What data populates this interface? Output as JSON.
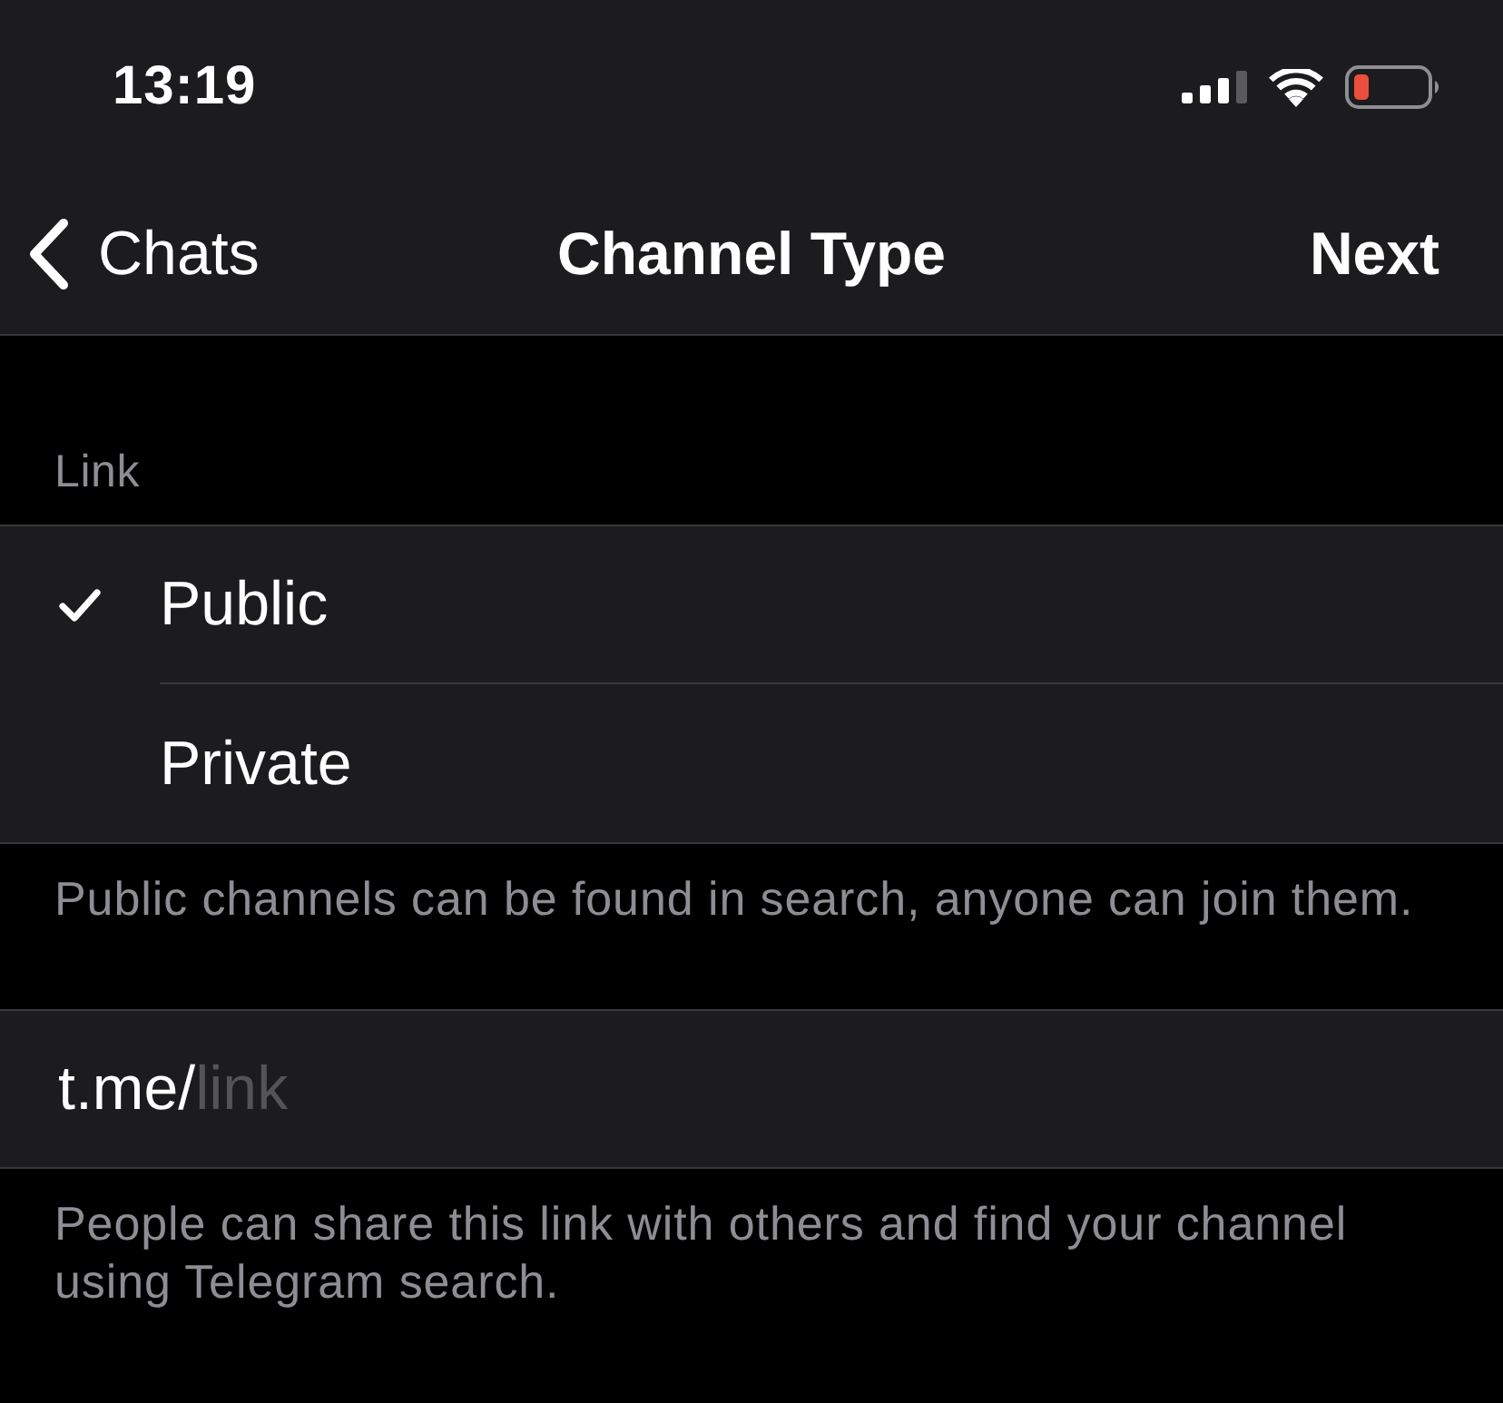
{
  "status_bar": {
    "time": "13:19"
  },
  "nav_bar": {
    "back_label": "Chats",
    "title": "Channel Type",
    "action": "Next"
  },
  "link_section": {
    "header": "Link",
    "options": [
      {
        "label": "Public",
        "selected": true
      },
      {
        "label": "Private",
        "selected": false
      }
    ],
    "footer": "Public channels can be found in search, anyone can join them."
  },
  "link_field": {
    "prefix": "t.me/",
    "placeholder": "link",
    "footer": "People can share this link with others and find your channel using Telegram search."
  }
}
